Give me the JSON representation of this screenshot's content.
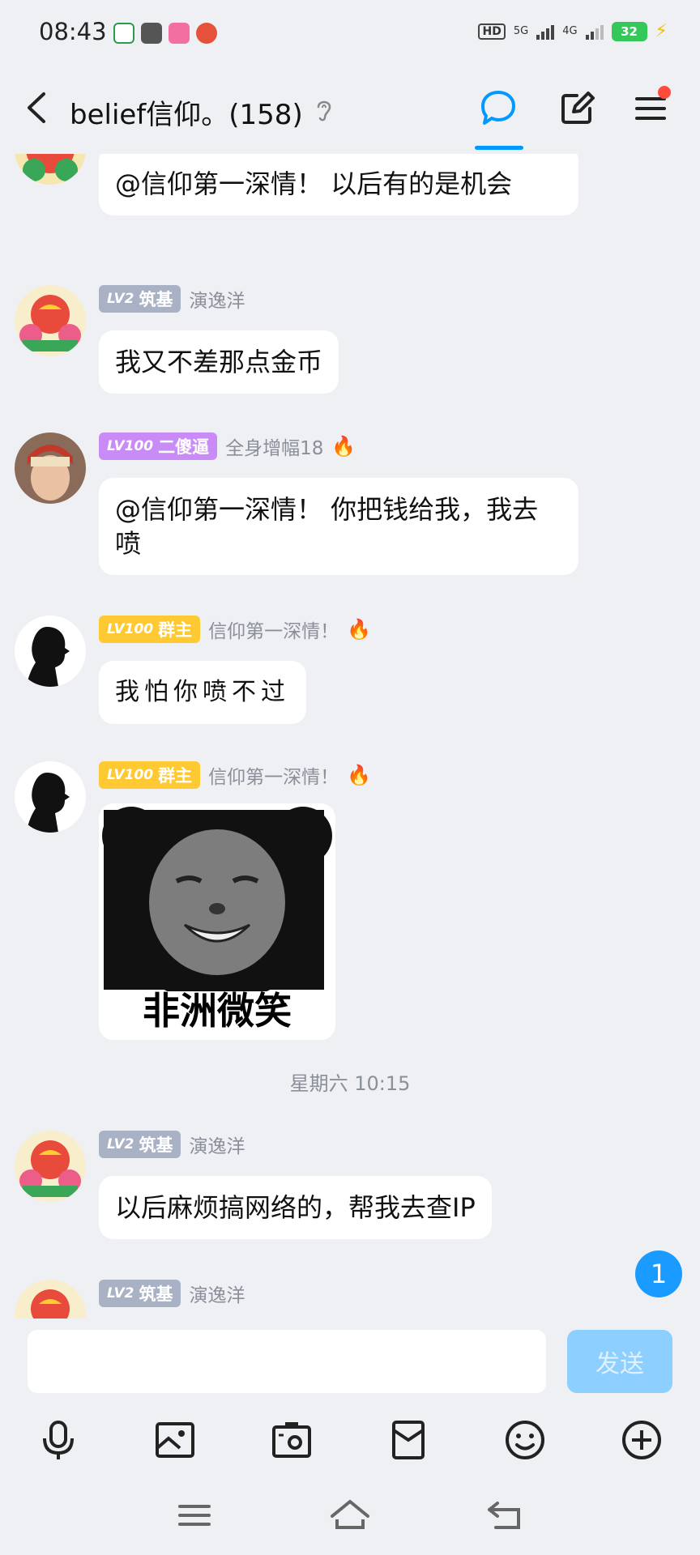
{
  "status": {
    "time": "08:43",
    "hd": "HD",
    "net1": "5G",
    "net2": "4G",
    "battery": "32"
  },
  "header": {
    "title": "belief信仰。(158)"
  },
  "messages": [
    {
      "type": "text",
      "text": "@信仰第一深情！ 以后有的是机会"
    },
    {
      "type": "text",
      "level": "LV2",
      "badge": "筑基",
      "nick": "演逸洋",
      "text": "我又不差那点金币"
    },
    {
      "type": "text",
      "level": "LV100",
      "badge": "二傻逼",
      "nick": "全身增幅18",
      "text": "@信仰第一深情！ 你把钱给我，我去喷"
    },
    {
      "type": "text",
      "level": "LV100",
      "badge": "群主",
      "nick": "信仰第一深情！",
      "text": "我怕你喷不过"
    },
    {
      "type": "sticker",
      "level": "LV100",
      "badge": "群主",
      "nick": "信仰第一深情！",
      "caption": "非洲微笑"
    },
    {
      "type": "text",
      "level": "LV2",
      "badge": "筑基",
      "nick": "演逸洋",
      "text": "以后麻烦搞网络的，帮我去查IP"
    },
    {
      "type": "partial",
      "level": "LV2",
      "badge": "筑基",
      "nick": "演逸洋"
    }
  ],
  "time_separator": "星期六 10:15",
  "unread_count": "1",
  "input": {
    "value": "",
    "send_label": "发送"
  },
  "colors": {
    "accent": "#0099ff",
    "send_disabled": "#8dcfff",
    "badge_grey": "#a9b1c4",
    "badge_purple": "#c98cf6",
    "badge_gold": "#ffc933"
  },
  "toolbar_icons": [
    "microphone-icon",
    "photo-icon",
    "camera-icon",
    "red-packet-icon",
    "emoji-icon",
    "plus-icon"
  ],
  "nav_icons": [
    "recent-apps-icon",
    "home-icon",
    "back-icon"
  ]
}
